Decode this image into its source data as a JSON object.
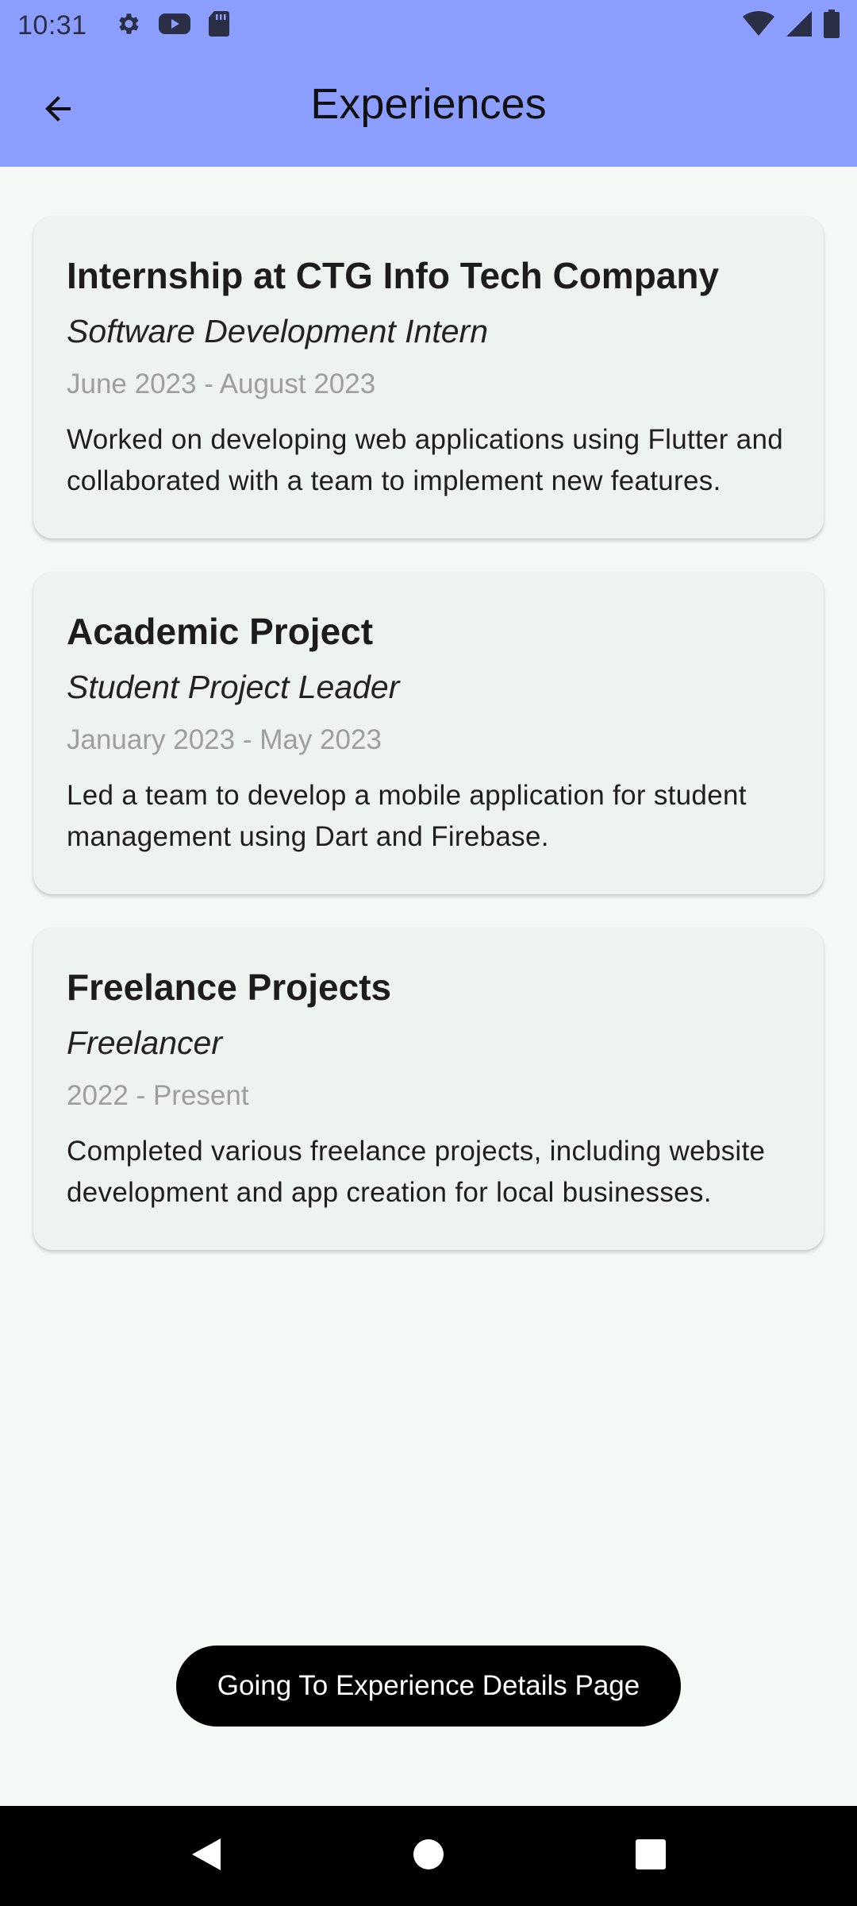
{
  "status_bar": {
    "time": "10:31",
    "left_icons": [
      "gear-icon",
      "youtube-icon",
      "sd-card-icon"
    ],
    "right_icons": [
      "wifi-icon",
      "signal-icon",
      "battery-icon"
    ]
  },
  "app_bar": {
    "title": "Experiences",
    "back_icon": "arrow-left-icon",
    "background": "#8c9eff"
  },
  "experiences": [
    {
      "title": "Internship at CTG Info Tech  Company",
      "role": "Software Development Intern",
      "dates": "June 2023 - August 2023",
      "description": "Worked on developing web applications using Flutter and collaborated with a team to implement new features."
    },
    {
      "title": "Academic Project",
      "role": "Student Project Leader",
      "dates": "January 2023 - May 2023",
      "description": "Led a team to develop a mobile application for student management using Dart and Firebase."
    },
    {
      "title": "Freelance Projects",
      "role": "Freelancer",
      "dates": "2022 - Present",
      "description": "Completed various freelance projects, including website development and app creation for local businesses."
    }
  ],
  "toast": {
    "text": "Going To Experience Details Page"
  },
  "nav_bar": {
    "buttons": [
      "back-triangle-icon",
      "home-circle-icon",
      "recents-square-icon"
    ]
  }
}
